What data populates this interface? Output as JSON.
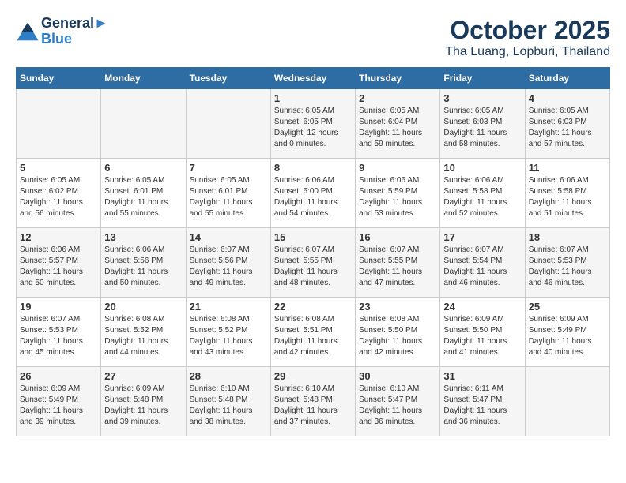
{
  "header": {
    "logo_line1": "General",
    "logo_line2": "Blue",
    "month": "October 2025",
    "location": "Tha Luang, Lopburi, Thailand"
  },
  "days_of_week": [
    "Sunday",
    "Monday",
    "Tuesday",
    "Wednesday",
    "Thursday",
    "Friday",
    "Saturday"
  ],
  "weeks": [
    [
      {
        "day": "",
        "info": ""
      },
      {
        "day": "",
        "info": ""
      },
      {
        "day": "",
        "info": ""
      },
      {
        "day": "1",
        "info": "Sunrise: 6:05 AM\nSunset: 6:05 PM\nDaylight: 12 hours\nand 0 minutes."
      },
      {
        "day": "2",
        "info": "Sunrise: 6:05 AM\nSunset: 6:04 PM\nDaylight: 11 hours\nand 59 minutes."
      },
      {
        "day": "3",
        "info": "Sunrise: 6:05 AM\nSunset: 6:03 PM\nDaylight: 11 hours\nand 58 minutes."
      },
      {
        "day": "4",
        "info": "Sunrise: 6:05 AM\nSunset: 6:03 PM\nDaylight: 11 hours\nand 57 minutes."
      }
    ],
    [
      {
        "day": "5",
        "info": "Sunrise: 6:05 AM\nSunset: 6:02 PM\nDaylight: 11 hours\nand 56 minutes."
      },
      {
        "day": "6",
        "info": "Sunrise: 6:05 AM\nSunset: 6:01 PM\nDaylight: 11 hours\nand 55 minutes."
      },
      {
        "day": "7",
        "info": "Sunrise: 6:05 AM\nSunset: 6:01 PM\nDaylight: 11 hours\nand 55 minutes."
      },
      {
        "day": "8",
        "info": "Sunrise: 6:06 AM\nSunset: 6:00 PM\nDaylight: 11 hours\nand 54 minutes."
      },
      {
        "day": "9",
        "info": "Sunrise: 6:06 AM\nSunset: 5:59 PM\nDaylight: 11 hours\nand 53 minutes."
      },
      {
        "day": "10",
        "info": "Sunrise: 6:06 AM\nSunset: 5:58 PM\nDaylight: 11 hours\nand 52 minutes."
      },
      {
        "day": "11",
        "info": "Sunrise: 6:06 AM\nSunset: 5:58 PM\nDaylight: 11 hours\nand 51 minutes."
      }
    ],
    [
      {
        "day": "12",
        "info": "Sunrise: 6:06 AM\nSunset: 5:57 PM\nDaylight: 11 hours\nand 50 minutes."
      },
      {
        "day": "13",
        "info": "Sunrise: 6:06 AM\nSunset: 5:56 PM\nDaylight: 11 hours\nand 50 minutes."
      },
      {
        "day": "14",
        "info": "Sunrise: 6:07 AM\nSunset: 5:56 PM\nDaylight: 11 hours\nand 49 minutes."
      },
      {
        "day": "15",
        "info": "Sunrise: 6:07 AM\nSunset: 5:55 PM\nDaylight: 11 hours\nand 48 minutes."
      },
      {
        "day": "16",
        "info": "Sunrise: 6:07 AM\nSunset: 5:55 PM\nDaylight: 11 hours\nand 47 minutes."
      },
      {
        "day": "17",
        "info": "Sunrise: 6:07 AM\nSunset: 5:54 PM\nDaylight: 11 hours\nand 46 minutes."
      },
      {
        "day": "18",
        "info": "Sunrise: 6:07 AM\nSunset: 5:53 PM\nDaylight: 11 hours\nand 46 minutes."
      }
    ],
    [
      {
        "day": "19",
        "info": "Sunrise: 6:07 AM\nSunset: 5:53 PM\nDaylight: 11 hours\nand 45 minutes."
      },
      {
        "day": "20",
        "info": "Sunrise: 6:08 AM\nSunset: 5:52 PM\nDaylight: 11 hours\nand 44 minutes."
      },
      {
        "day": "21",
        "info": "Sunrise: 6:08 AM\nSunset: 5:52 PM\nDaylight: 11 hours\nand 43 minutes."
      },
      {
        "day": "22",
        "info": "Sunrise: 6:08 AM\nSunset: 5:51 PM\nDaylight: 11 hours\nand 42 minutes."
      },
      {
        "day": "23",
        "info": "Sunrise: 6:08 AM\nSunset: 5:50 PM\nDaylight: 11 hours\nand 42 minutes."
      },
      {
        "day": "24",
        "info": "Sunrise: 6:09 AM\nSunset: 5:50 PM\nDaylight: 11 hours\nand 41 minutes."
      },
      {
        "day": "25",
        "info": "Sunrise: 6:09 AM\nSunset: 5:49 PM\nDaylight: 11 hours\nand 40 minutes."
      }
    ],
    [
      {
        "day": "26",
        "info": "Sunrise: 6:09 AM\nSunset: 5:49 PM\nDaylight: 11 hours\nand 39 minutes."
      },
      {
        "day": "27",
        "info": "Sunrise: 6:09 AM\nSunset: 5:48 PM\nDaylight: 11 hours\nand 39 minutes."
      },
      {
        "day": "28",
        "info": "Sunrise: 6:10 AM\nSunset: 5:48 PM\nDaylight: 11 hours\nand 38 minutes."
      },
      {
        "day": "29",
        "info": "Sunrise: 6:10 AM\nSunset: 5:48 PM\nDaylight: 11 hours\nand 37 minutes."
      },
      {
        "day": "30",
        "info": "Sunrise: 6:10 AM\nSunset: 5:47 PM\nDaylight: 11 hours\nand 36 minutes."
      },
      {
        "day": "31",
        "info": "Sunrise: 6:11 AM\nSunset: 5:47 PM\nDaylight: 11 hours\nand 36 minutes."
      },
      {
        "day": "",
        "info": ""
      }
    ]
  ]
}
